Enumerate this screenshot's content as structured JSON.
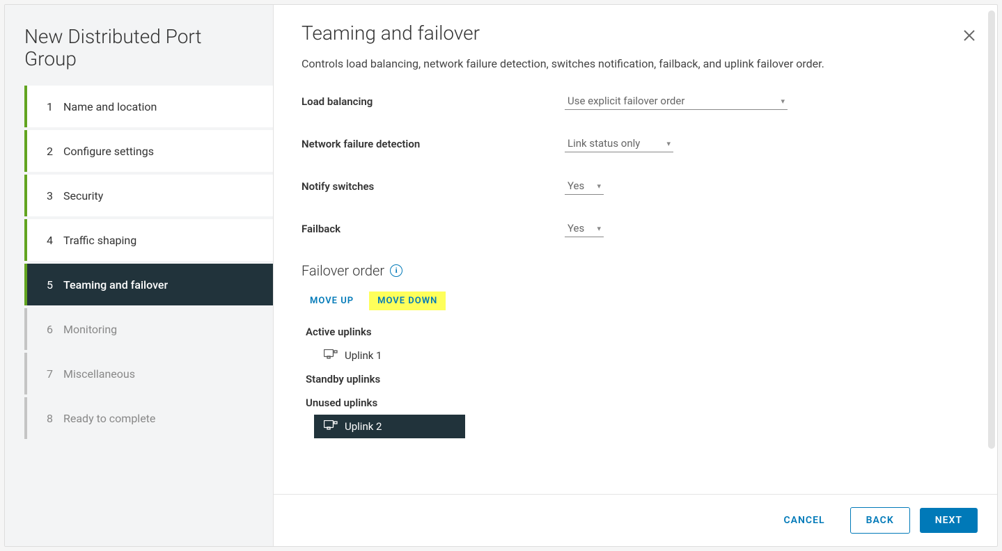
{
  "wizard_title": "New Distributed Port Group",
  "steps": [
    {
      "num": "1",
      "label": "Name and location",
      "state": "completed"
    },
    {
      "num": "2",
      "label": "Configure settings",
      "state": "completed"
    },
    {
      "num": "3",
      "label": "Security",
      "state": "completed"
    },
    {
      "num": "4",
      "label": "Traffic shaping",
      "state": "completed"
    },
    {
      "num": "5",
      "label": "Teaming and failover",
      "state": "active"
    },
    {
      "num": "6",
      "label": "Monitoring",
      "state": "pending"
    },
    {
      "num": "7",
      "label": "Miscellaneous",
      "state": "pending"
    },
    {
      "num": "8",
      "label": "Ready to complete",
      "state": "pending"
    }
  ],
  "page": {
    "title": "Teaming and failover",
    "description": "Controls load balancing, network failure detection, switches notification, failback, and uplink failover order."
  },
  "form": {
    "load_balancing": {
      "label": "Load balancing",
      "value": "Use explicit failover order"
    },
    "network_failure_detection": {
      "label": "Network failure detection",
      "value": "Link status only"
    },
    "notify_switches": {
      "label": "Notify switches",
      "value": "Yes"
    },
    "failback": {
      "label": "Failback",
      "value": "Yes"
    }
  },
  "failover": {
    "section_label": "Failover order",
    "move_up": "MOVE UP",
    "move_down": "MOVE DOWN",
    "active_label": "Active uplinks",
    "standby_label": "Standby uplinks",
    "unused_label": "Unused uplinks",
    "active": [
      {
        "name": "Uplink 1"
      }
    ],
    "standby": [],
    "unused": [
      {
        "name": "Uplink 2",
        "selected": true
      }
    ]
  },
  "footer": {
    "cancel": "CANCEL",
    "back": "BACK",
    "next": "NEXT"
  }
}
